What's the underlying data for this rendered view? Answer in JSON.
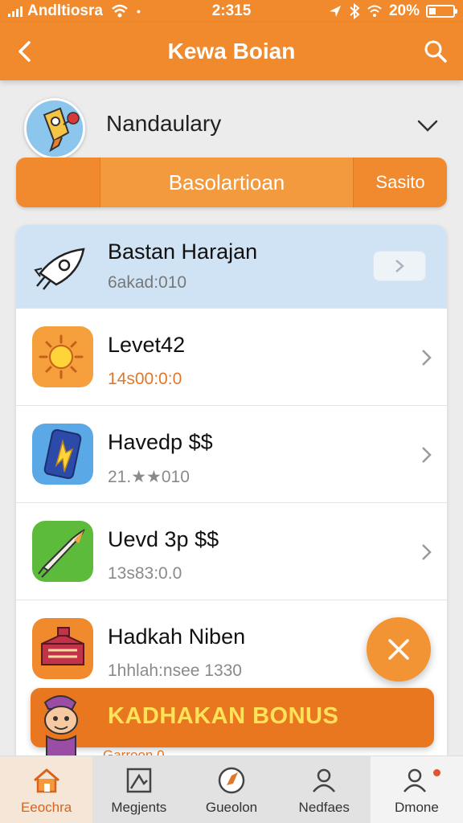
{
  "status_bar": {
    "carrier": "Andltiosra",
    "time": "2:315",
    "battery": "20%"
  },
  "app_bar": {
    "title": "Kewa Boian"
  },
  "profile": {
    "name": "Nandaulary"
  },
  "segment_bar": {
    "main_label": "Basolartioan",
    "side_label": "Sasito"
  },
  "list": [
    {
      "title": "Bastan Harajan",
      "subtitle": "6akad:010",
      "icon": "rocket-icon",
      "featured": true
    },
    {
      "title": "Levet42",
      "subtitle": "14s00:0:0",
      "icon": "sun-icon"
    },
    {
      "title": "Havedp $$",
      "subtitle": "21.★★010",
      "icon": "phone-boost-icon"
    },
    {
      "title": "Uevd 3p $$",
      "subtitle": "13s83:0.0",
      "icon": "missile-icon"
    },
    {
      "title": "Hadkah Niben",
      "subtitle": "1hhlah:nsee 1330",
      "icon": "treasure-chest-icon"
    }
  ],
  "banner": {
    "text": "KADHAKAN BONUS",
    "peek_text": "Garroon 0"
  },
  "bottom_nav": [
    {
      "label": "Eeochra",
      "icon": "home-icon",
      "active": true
    },
    {
      "label": "Megjents",
      "icon": "picture-icon"
    },
    {
      "label": "Gueolon",
      "icon": "compass-icon"
    },
    {
      "label": "Nedfaes",
      "icon": "user-icon"
    },
    {
      "label": "Dmone",
      "icon": "profile-icon"
    }
  ],
  "colors": {
    "accent": "#f08a2c",
    "banner": "#e9771f",
    "banner_text": "#ffe15a",
    "featured_row": "#cfe3f5"
  }
}
